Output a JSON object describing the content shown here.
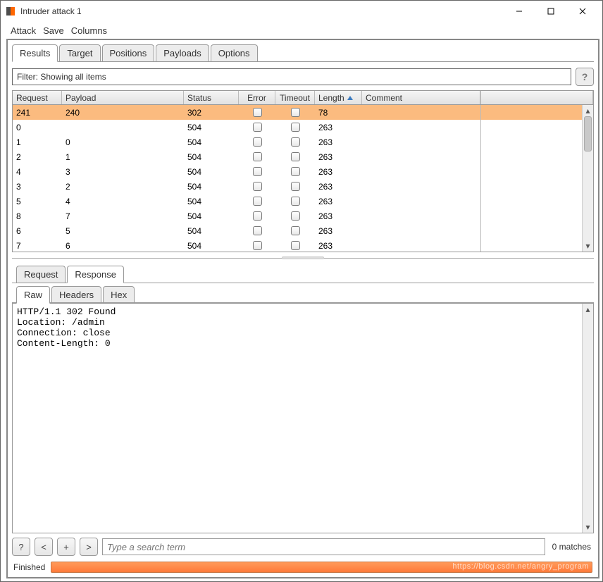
{
  "window": {
    "title": "Intruder attack 1"
  },
  "menu": {
    "attack": "Attack",
    "save": "Save",
    "columns": "Columns"
  },
  "main_tabs": {
    "results": "Results",
    "target": "Target",
    "positions": "Positions",
    "payloads": "Payloads",
    "options": "Options"
  },
  "filter": {
    "text": "Filter: Showing all items",
    "help": "?"
  },
  "table": {
    "headers": {
      "request": "Request",
      "payload": "Payload",
      "status": "Status",
      "error": "Error",
      "timeout": "Timeout",
      "length": "Length",
      "comment": "Comment"
    },
    "rows": [
      {
        "request": "241",
        "payload": "240",
        "status": "302",
        "length": "78",
        "selected": true
      },
      {
        "request": "0",
        "payload": "",
        "status": "504",
        "length": "263"
      },
      {
        "request": "1",
        "payload": "0",
        "status": "504",
        "length": "263"
      },
      {
        "request": "2",
        "payload": "1",
        "status": "504",
        "length": "263"
      },
      {
        "request": "4",
        "payload": "3",
        "status": "504",
        "length": "263"
      },
      {
        "request": "3",
        "payload": "2",
        "status": "504",
        "length": "263"
      },
      {
        "request": "5",
        "payload": "4",
        "status": "504",
        "length": "263"
      },
      {
        "request": "8",
        "payload": "7",
        "status": "504",
        "length": "263"
      },
      {
        "request": "6",
        "payload": "5",
        "status": "504",
        "length": "263"
      },
      {
        "request": "7",
        "payload": "6",
        "status": "504",
        "length": "263"
      }
    ]
  },
  "detail_tabs": {
    "request": "Request",
    "response": "Response"
  },
  "view_tabs": {
    "raw": "Raw",
    "headers": "Headers",
    "hex": "Hex"
  },
  "response_text": "HTTP/1.1 302 Found\nLocation: /admin\nConnection: close\nContent-Length: 0",
  "search": {
    "help": "?",
    "prev": "<",
    "add": "+",
    "next": ">",
    "placeholder": "Type a search term",
    "matches": "0 matches"
  },
  "status": {
    "label": "Finished",
    "watermark": "https://blog.csdn.net/angry_program"
  }
}
